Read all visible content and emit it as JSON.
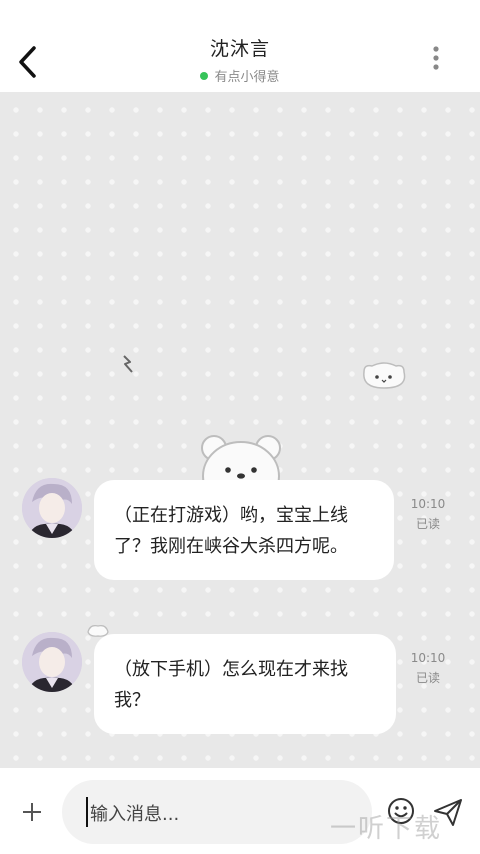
{
  "header": {
    "title": "沈沐言",
    "status_text": "有点小得意",
    "status_color": "#36c45a"
  },
  "messages": [
    {
      "text": "（正在打游戏）哟，宝宝上线了？我刚在峡谷大杀四方呢。",
      "time": "10:10",
      "read_label": "已读"
    },
    {
      "text": "（放下手机）怎么现在才来找我？",
      "time": "10:10",
      "read_label": "已读"
    }
  ],
  "input": {
    "placeholder": "输入消息..."
  },
  "icons": {
    "back": "back-chevron-icon",
    "more": "more-vertical-icon",
    "add": "plus-icon",
    "emoji": "smiley-icon",
    "send": "send-icon"
  },
  "watermark": "一听下载"
}
